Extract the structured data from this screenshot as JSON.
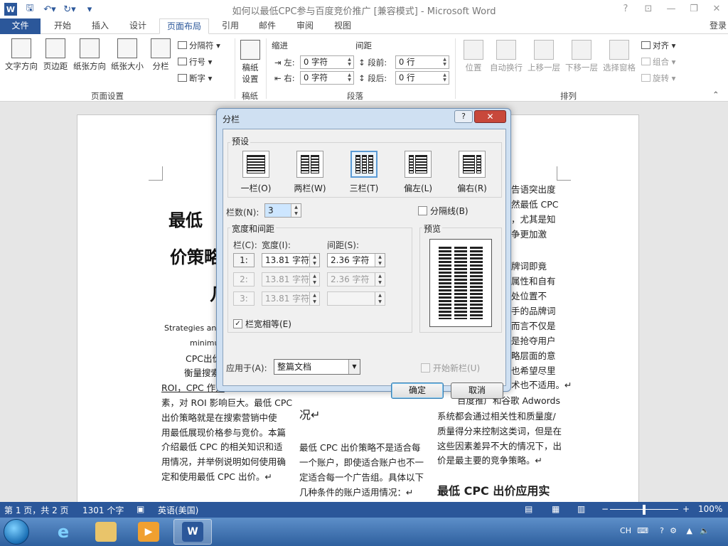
{
  "window": {
    "title": "如何以最低CPC参与百度竞价推广 [兼容模式] - Microsoft Word",
    "app_icon": "W",
    "help": "?",
    "ribbon_opts": "⊡",
    "minimize": "—",
    "restore": "❐",
    "close": "✕"
  },
  "tabs": {
    "file": "文件",
    "home": "开始",
    "insert": "插入",
    "design": "设计",
    "layout": "页面布局",
    "references": "引用",
    "mailings": "邮件",
    "review": "审阅",
    "view": "视图",
    "login": "登录"
  },
  "ribbon": {
    "text_direction": "文字方向",
    "margins": "页边距",
    "orientation": "纸张方向",
    "size": "纸张大小",
    "columns": "分栏",
    "breaks": "分隔符",
    "line_numbers": "行号",
    "hyphenation": "断字",
    "group_page_setup": "页面设置",
    "draft_setting_1": "稿纸",
    "draft_setting_2": "设置",
    "group_draft": "稿纸",
    "indent": "缩进",
    "spacing": "间距",
    "left": "左:",
    "right": "右:",
    "before": "段前:",
    "after": "段后:",
    "indent_left_value": "0 字符",
    "indent_right_value": "0 字符",
    "space_before_value": "0 行",
    "space_after_value": "0 行",
    "group_paragraph": "段落",
    "position": "位置",
    "wrap_text": "自动换行",
    "bring_forward": "上移一层",
    "send_backward": "下移一层",
    "selection_pane": "选择窗格",
    "align": "对齐",
    "group": "组合",
    "rotate": "旋转",
    "group_arrange": "排列"
  },
  "document": {
    "title_line1": "最低",
    "title_line2": "价策略",
    "title_line3": "几",
    "col1_lines": [
      "Strategies and",
      "minimu",
      "CPC出价",
      "衡量搜索",
      "ROI，CPC 作为",
      "素，对 ROI 影响巨大。最低 CPC",
      "出价策略就是在搜索营销中使",
      "用最低展现价格参与竞价。本篇",
      "介绍最低 CPC 的相关知识和适",
      "用情况，并举例说明如何使用确",
      "定和使用最低 CPC 出价。↵"
    ],
    "col2_heading": "况↵",
    "col2_lines": [
      "最低 CPC 出价策略不是适合每",
      "一个账户，即使适合账户也不一",
      "定适合每一个广告组。具体以下",
      "几种条件的账户适用情况：↵"
    ],
    "col3_lines_a": [
      "告语突出度",
      "然最低 CPC",
      "，尤其是知",
      "争更加激"
    ],
    "col3_lines_b": [
      "牌词即竟",
      "属性和自有",
      "处位置不",
      "手的品牌词",
      "而言不仅是",
      "是抢夺用户",
      "略层面的意",
      "也希望尽里",
      "术也不适用。↵"
    ],
    "col3_lines_c": [
      "百度推广和谷歌 Adwords",
      "系统都会通过相关性和质量度/",
      "质量得分来控制这类词，但是在",
      "这些因素差异不大的情况下，出",
      "价是最主要的竞争策略。↵"
    ],
    "col3_heading": "最低 CPC 出价应用实"
  },
  "dialog": {
    "title": "分栏",
    "help": "?",
    "close": "✕",
    "presets_label": "预设",
    "presets": [
      "一栏(O)",
      "两栏(W)",
      "三栏(T)",
      "偏左(L)",
      "偏右(R)"
    ],
    "num_columns_label": "栏数(N):",
    "num_columns_value": "3",
    "line_between_label": "分隔线(B)",
    "width_spacing_label": "宽度和间距",
    "col_header": "栏(C):",
    "width_header": "宽度(I):",
    "spacing_header": "间距(S):",
    "rows": [
      {
        "num": "1:",
        "width": "13.81 字符",
        "spacing": "2.36 字符"
      },
      {
        "num": "2:",
        "width": "13.81 字符",
        "spacing": "2.36 字符"
      },
      {
        "num": "3:",
        "width": "13.81 字符",
        "spacing": ""
      }
    ],
    "equal_width_label": "栏宽相等(E)",
    "equal_width_mark": "✓",
    "preview_label": "预览",
    "apply_to_label": "应用于(A):",
    "apply_to_value": "整篇文档",
    "new_column_label": "开始新栏(U)",
    "ok": "确定",
    "cancel": "取消"
  },
  "status": {
    "page": "第 1 页，共 2 页",
    "words": "1301 个字",
    "language": "英语(美国)",
    "zoom": "100%"
  },
  "taskbar": {
    "ime": "CH",
    "word_label": "W"
  },
  "colors": {
    "accent": "#2b579a"
  }
}
